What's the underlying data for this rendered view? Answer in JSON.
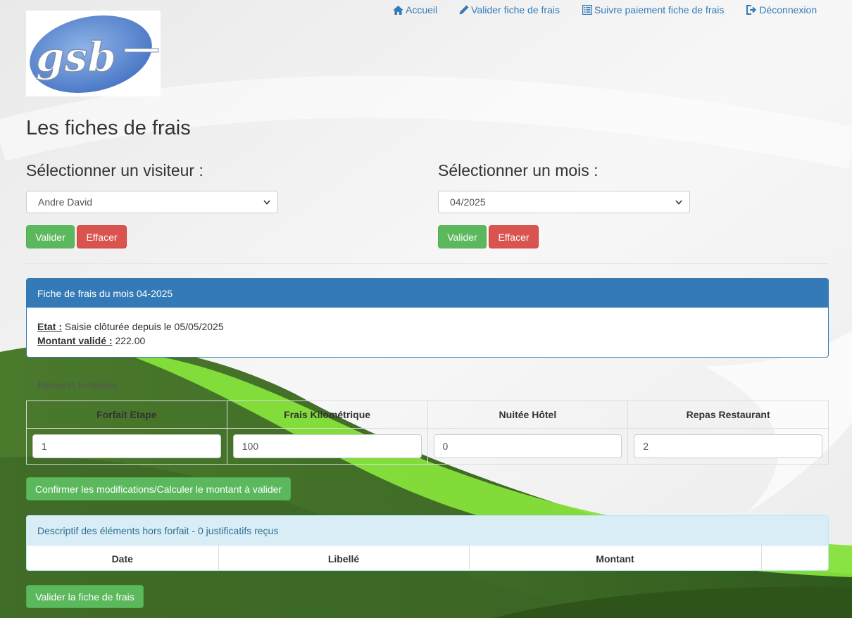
{
  "logo": {
    "text": "gsb"
  },
  "nav": {
    "home": "Accueil",
    "validate": "Valider fiche de frais",
    "follow": "Suivre paiement fiche de frais",
    "logout": "Déconnexion"
  },
  "page_title": "Les fiches de frais",
  "visitor": {
    "label": "Sélectionner un visiteur :",
    "selected": "Andre David",
    "validate_label": "Valider",
    "clear_label": "Effacer"
  },
  "month": {
    "label": "Sélectionner un mois :",
    "selected": "04/2025",
    "validate_label": "Valider",
    "clear_label": "Effacer"
  },
  "fiche": {
    "heading": "Fiche de frais du mois 04-2025",
    "etat_label": "Etat :",
    "etat_value": "Saisie clôturée depuis le 05/05/2025",
    "montant_label": "Montant validé :",
    "montant_value": "222.00"
  },
  "forfait": {
    "caption": "Eléments forfaitisés",
    "headers": [
      "Forfait Etape",
      "Frais Kilométrique",
      "Nuitée Hôtel",
      "Repas Restaurant"
    ],
    "values": [
      "1",
      "100",
      "0",
      "2"
    ],
    "confirm_label": "Confirmer les modifications/Calculer le montant à valider"
  },
  "hors_forfait": {
    "heading": "Descriptif des éléments hors forfait - 0 justificatifs reçus",
    "headers": [
      "Date",
      "Libellé",
      "Montant",
      ""
    ]
  },
  "validate_fiche_label": "Valider la fiche de frais",
  "colors": {
    "primary": "#337ab7",
    "success": "#5cb85c",
    "danger": "#d9534f",
    "info_bg": "#d9edf7",
    "green_dark": "#3f6c2a",
    "green_light": "#8fe53a"
  }
}
